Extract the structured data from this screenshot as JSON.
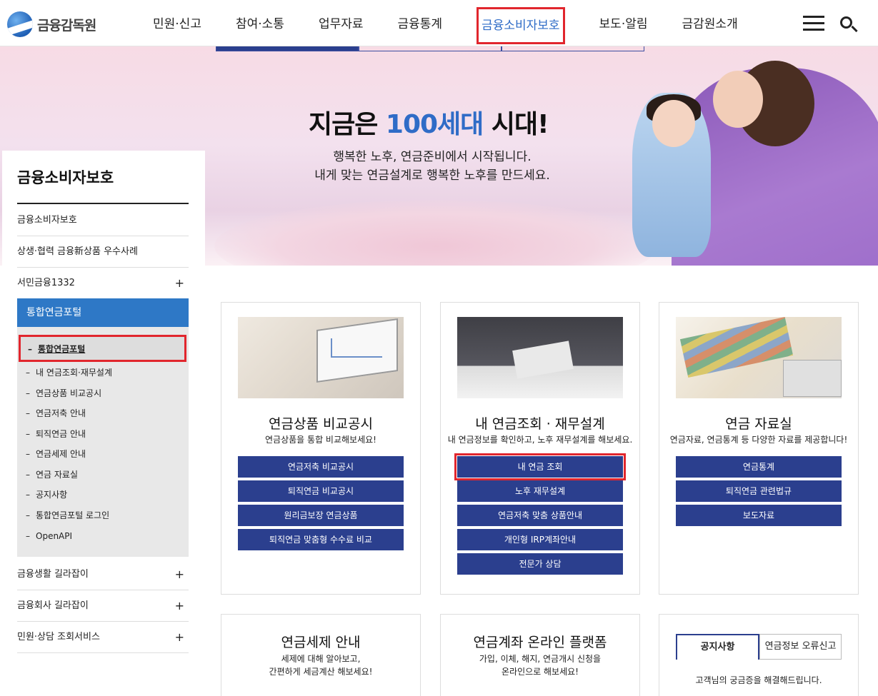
{
  "header": {
    "logo_text": "금융감독원",
    "nav": [
      "민원·신고",
      "참여·소통",
      "업무자료",
      "금융통계",
      "금융소비자보호",
      "보도·알림",
      "금감원소개"
    ],
    "active_index": 4
  },
  "banner": {
    "title_pre": "지금은 ",
    "title_highlight": "100세대",
    "title_post": " 시대!",
    "subtitle_line1": "행복한 노후, 연금준비에서 시작됩니다.",
    "subtitle_line2": "내게 맞는 연금설계로 행복한 노후를 만드세요."
  },
  "sidebar": {
    "title": "금융소비자보호",
    "items_top": [
      {
        "label": "금융소비자보호"
      },
      {
        "label": "상생·협력 금융新상품 우수사례"
      },
      {
        "label": "서민금융1332",
        "plus": "+"
      }
    ],
    "active_label": "통합연금포털",
    "sub_items": [
      "통합연금포털",
      "내 연금조회·재무설계",
      "연금상품 비교공시",
      "연금저축 안내",
      "퇴직연금 안내",
      "연금세제 안내",
      "연금 자료실",
      "공지사항",
      "통합연금포털 로그인",
      "OpenAPI"
    ],
    "items_bottom": [
      {
        "label": "금융생활 길라잡이",
        "plus": "+"
      },
      {
        "label": "금융회사 길라잡이",
        "plus": "+"
      },
      {
        "label": "민원·상담 조회서비스",
        "plus": "+"
      }
    ]
  },
  "cards": {
    "compare": {
      "title": "연금상품 비교공시",
      "desc": "연금상품을 통합 비교해보세요!",
      "buttons": [
        "연금저축 비교공시",
        "퇴직연금 비교공시",
        "원리금보장 연금상품",
        "퇴직연금 맞춤형 수수료 비교"
      ]
    },
    "mypension": {
      "title": "내 연금조회 · 재무설계",
      "desc": "내 연금정보를 확인하고, 노후 재무설계를 해보세요.",
      "buttons": [
        "내 연금 조회",
        "노후 재무설계",
        "연금저축 맞춤 상품안내",
        "개인형 IRP계좌안내",
        "전문가 상담"
      ]
    },
    "library": {
      "title": "연금 자료실",
      "desc": "연금자료, 연금통계 등 다양한 자료를 제공합니다!",
      "buttons": [
        "연금통계",
        "퇴직연금 관련법규",
        "보도자료"
      ]
    },
    "tax": {
      "title": "연금세제 안내",
      "desc_line1": "세제에 대해 알아보고,",
      "desc_line2": "간편하게 세금계산 해보세요!"
    },
    "platform": {
      "title": "연금계좌 온라인 플랫폼",
      "desc_line1": "가입, 이체, 해지, 연금개시 신청을",
      "desc_line2": "온라인으로 해보세요!"
    },
    "notice": {
      "tabs": [
        "공지사항",
        "연금정보 오류신고"
      ],
      "text": "고객님의 궁금증을 해결해드립니다."
    }
  }
}
